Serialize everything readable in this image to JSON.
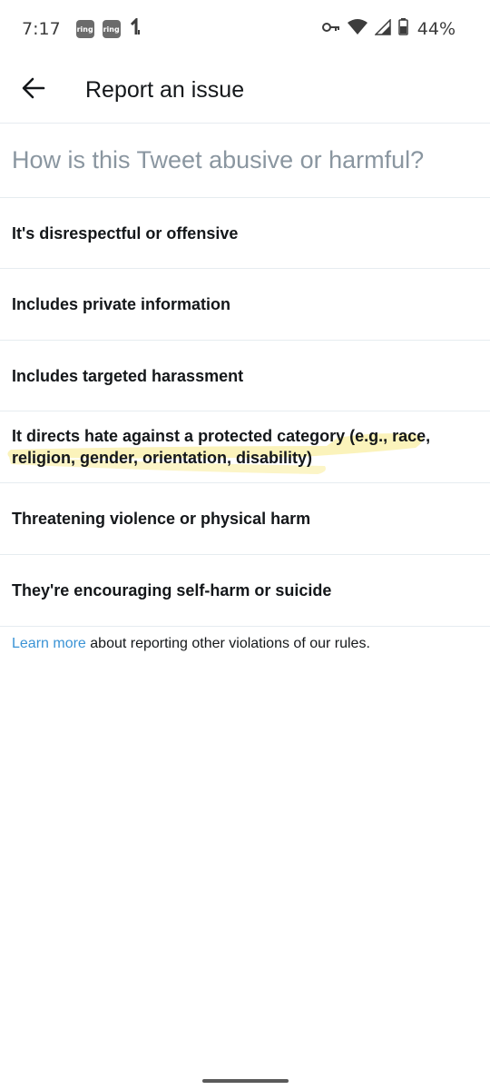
{
  "status_bar": {
    "time": "7:17",
    "ring_badge_1": "ring",
    "ring_badge_2": "ring",
    "battery": "44%"
  },
  "header": {
    "title": "Report an issue"
  },
  "prompt": "How is this Tweet abusive or harmful?",
  "options": [
    {
      "label": "It's disrespectful or offensive"
    },
    {
      "label": "Includes private information"
    },
    {
      "label": "Includes targeted harassment"
    },
    {
      "label_part1": "It directs hate against a protected category (e.g., race,",
      "label_part2": "religion, gender, orientation, disability)"
    },
    {
      "label": "Threatening violence or physical harm"
    },
    {
      "label": "They're encouraging self-harm or suicide"
    }
  ],
  "footer": {
    "link_text": "Learn more",
    "rest_text": " about reporting other violations of our rules."
  },
  "colors": {
    "link": "#3a93d5",
    "highlight": "#fbf2b4",
    "divider": "#e6ecf0"
  }
}
